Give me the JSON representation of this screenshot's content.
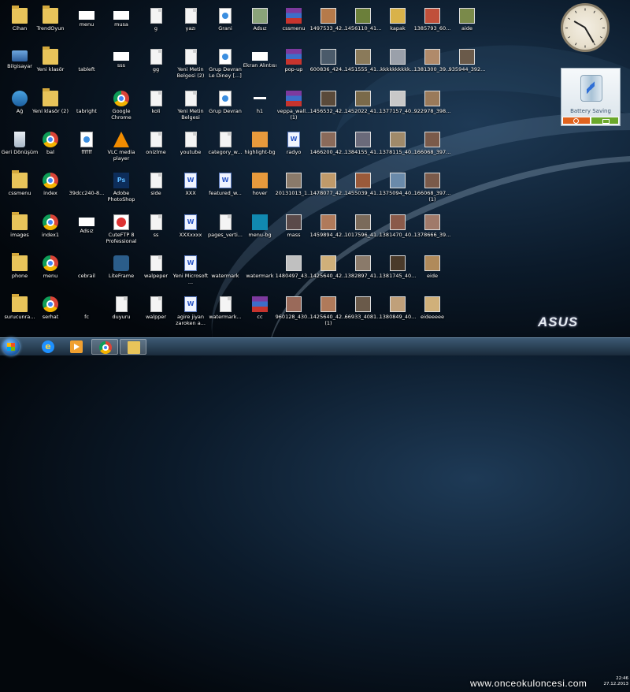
{
  "desktop": {
    "icons": [
      {
        "label": "Cihan",
        "type": "folder"
      },
      {
        "label": "TrendOyun",
        "type": "folder"
      },
      {
        "label": "menu",
        "type": "white"
      },
      {
        "label": "musa",
        "type": "white"
      },
      {
        "label": "g",
        "type": "page"
      },
      {
        "label": "yazı",
        "type": "page"
      },
      {
        "label": "Grani",
        "type": "html"
      },
      {
        "label": "Adsız",
        "type": "thumb",
        "color": "#8aa37a"
      },
      {
        "label": "cssmenu",
        "type": "winrar"
      },
      {
        "label": "1497533_42...",
        "type": "thumb",
        "color": "#b57a4a"
      },
      {
        "label": "1456110_41...",
        "type": "thumb",
        "color": "#6b7f3a"
      },
      {
        "label": "kapak",
        "type": "thumb",
        "color": "#d9b24a"
      },
      {
        "label": "1385793_60...",
        "type": "thumb",
        "color": "#c0503a"
      },
      {
        "label": "aide",
        "type": "thumb",
        "color": "#7a8a4a"
      },
      {
        "label": "Bilgisayar",
        "type": "pc"
      },
      {
        "label": "Yeni klasör",
        "type": "folder"
      },
      {
        "label": "tableft",
        "type": "none"
      },
      {
        "label": "sss",
        "type": "white"
      },
      {
        "label": "gg",
        "type": "page"
      },
      {
        "label": "Yeni Metin Belgesi (2)",
        "type": "page"
      },
      {
        "label": "Grup Devran Le Diney [...]",
        "type": "html"
      },
      {
        "label": "Ekran Alıntısı",
        "type": "white"
      },
      {
        "label": "pop-up",
        "type": "winrar"
      },
      {
        "label": "600836_424...",
        "type": "thumb",
        "color": "#4a5a6a"
      },
      {
        "label": "1451555_41...",
        "type": "thumb",
        "color": "#8a7a5a"
      },
      {
        "label": "kkkkkkkkkk...",
        "type": "thumb",
        "color": "#9aa0aa"
      },
      {
        "label": "1381300_39...",
        "type": "thumb",
        "color": "#b08a6a"
      },
      {
        "label": "935944_392...",
        "type": "thumb",
        "color": "#6a5a4a"
      },
      {
        "label": "Ağ",
        "type": "net"
      },
      {
        "label": "Yeni klasör (2)",
        "type": "folder"
      },
      {
        "label": "tabright",
        "type": "none"
      },
      {
        "label": "Google Chrome",
        "type": "chrome"
      },
      {
        "label": "koli",
        "type": "page"
      },
      {
        "label": "Yeni Metin Belgesi",
        "type": "page"
      },
      {
        "label": "Grup Devran",
        "type": "html"
      },
      {
        "label": "h1",
        "type": "hline"
      },
      {
        "label": "veppa_wall... (1)",
        "type": "winrar"
      },
      {
        "label": "1456532_42...",
        "type": "thumb",
        "color": "#5a4a3a"
      },
      {
        "label": "1452022_41...",
        "type": "thumb",
        "color": "#7a6a4a"
      },
      {
        "label": "1377157_40...",
        "type": "thumb",
        "color": "#c8c8c8"
      },
      {
        "label": "922978_398...",
        "type": "thumb",
        "color": "#9a7a5a"
      },
      {
        "label": "Geri Dönüşüm",
        "type": "bin"
      },
      {
        "label": "bal",
        "type": "chrome"
      },
      {
        "label": "ffffff",
        "type": "html"
      },
      {
        "label": "VLC media player",
        "type": "vlc"
      },
      {
        "label": "onizlme",
        "type": "page"
      },
      {
        "label": "youtube",
        "type": "page"
      },
      {
        "label": "category_w...",
        "type": "page"
      },
      {
        "label": "highlight-bg",
        "type": "orange"
      },
      {
        "label": "radyo",
        "type": "doc"
      },
      {
        "label": "1466200_42...",
        "type": "thumb",
        "color": "#8a6a5a"
      },
      {
        "label": "1384155_41...",
        "type": "thumb",
        "color": "#6a6a7a"
      },
      {
        "label": "1378115_40...",
        "type": "thumb",
        "color": "#a08a6a"
      },
      {
        "label": "166068_397...",
        "type": "thumb",
        "color": "#7a5a4a"
      },
      {
        "label": "cssmenu",
        "type": "folder"
      },
      {
        "label": "index",
        "type": "chrome"
      },
      {
        "label": "39dcc240-8...",
        "type": "none"
      },
      {
        "label": "Adobe PhotoShop",
        "type": "ps"
      },
      {
        "label": "side",
        "type": "page"
      },
      {
        "label": "XXX",
        "type": "doc"
      },
      {
        "label": "featured_w...",
        "type": "doc"
      },
      {
        "label": "hover",
        "type": "orange"
      },
      {
        "label": "20131013_1...",
        "type": "thumb",
        "color": "#8a7a6a"
      },
      {
        "label": "1478077_42...",
        "type": "thumb",
        "color": "#c09a6a"
      },
      {
        "label": "1455039_41...",
        "type": "thumb",
        "color": "#9a5a3a"
      },
      {
        "label": "1375094_40...",
        "type": "thumb",
        "color": "#6a8aaa"
      },
      {
        "label": "166068_397... (1)",
        "type": "thumb",
        "color": "#7a5a4a"
      },
      {
        "label": "images",
        "type": "folder"
      },
      {
        "label": "index1",
        "type": "chrome"
      },
      {
        "label": "Adsız",
        "type": "white"
      },
      {
        "label": "CuteFTP 8 Professional",
        "type": "cuteftp"
      },
      {
        "label": "ss",
        "type": "page"
      },
      {
        "label": "XXXxxxx",
        "type": "doc"
      },
      {
        "label": "pages_verti...",
        "type": "page"
      },
      {
        "label": "menu-bg",
        "type": "teal"
      },
      {
        "label": "mass",
        "type": "thumb",
        "color": "#5a4a4a"
      },
      {
        "label": "1459894_42...",
        "type": "thumb",
        "color": "#b07a5a"
      },
      {
        "label": "1017596_41...",
        "type": "thumb",
        "color": "#7a6a5a"
      },
      {
        "label": "1381470_40...",
        "type": "thumb",
        "color": "#8a5a4a"
      },
      {
        "label": "1378666_39...",
        "type": "thumb",
        "color": "#a07a6a"
      },
      {
        "label": "phone",
        "type": "folder"
      },
      {
        "label": "menu",
        "type": "chrome"
      },
      {
        "label": "cebrail",
        "type": "none"
      },
      {
        "label": "LiteFrame",
        "type": "lm"
      },
      {
        "label": "walpeper",
        "type": "page"
      },
      {
        "label": "Yeni Microsoft ...",
        "type": "doc"
      },
      {
        "label": "watermark",
        "type": "none"
      },
      {
        "label": "watermark",
        "type": "none"
      },
      {
        "label": "1480497_43...",
        "type": "thumb",
        "color": "#c0c0c0"
      },
      {
        "label": "1425640_42...",
        "type": "thumb",
        "color": "#d0b07a"
      },
      {
        "label": "1382897_41...",
        "type": "thumb",
        "color": "#8a7a6a"
      },
      {
        "label": "1381745_40...",
        "type": "thumb",
        "color": "#4a3a2a"
      },
      {
        "label": "eide",
        "type": "thumb",
        "color": "#b08a5a"
      },
      {
        "label": "surucunra...",
        "type": "folder"
      },
      {
        "label": "serhat",
        "type": "chrome"
      },
      {
        "label": "fc",
        "type": "none"
      },
      {
        "label": "duyuru",
        "type": "page"
      },
      {
        "label": "walpper",
        "type": "page"
      },
      {
        "label": "agire jiyan zaroken a...",
        "type": "doc"
      },
      {
        "label": "watermark...",
        "type": "page"
      },
      {
        "label": "cc",
        "type": "winrar"
      },
      {
        "label": "960128_430...",
        "type": "thumb",
        "color": "#9a6a5a"
      },
      {
        "label": "1425640_42... (1)",
        "type": "thumb",
        "color": "#b07a5a"
      },
      {
        "label": "66933_4081...",
        "type": "thumb",
        "color": "#6a5a4a"
      },
      {
        "label": "1380849_40...",
        "type": "thumb",
        "color": "#c0a07a"
      },
      {
        "label": "eideeeee",
        "type": "thumb",
        "color": "#d0b07a"
      }
    ]
  },
  "gadgets": {
    "clock": {
      "hour_angle": 300,
      "minute_angle": 150
    },
    "battery": {
      "title": "Battery Saving"
    }
  },
  "brand": {
    "logo_text": "ASUS"
  },
  "taskbar": {
    "watermark": "www.onceokuloncesi.com",
    "tray_time": "22:46",
    "tray_date": "27.12.2013"
  }
}
